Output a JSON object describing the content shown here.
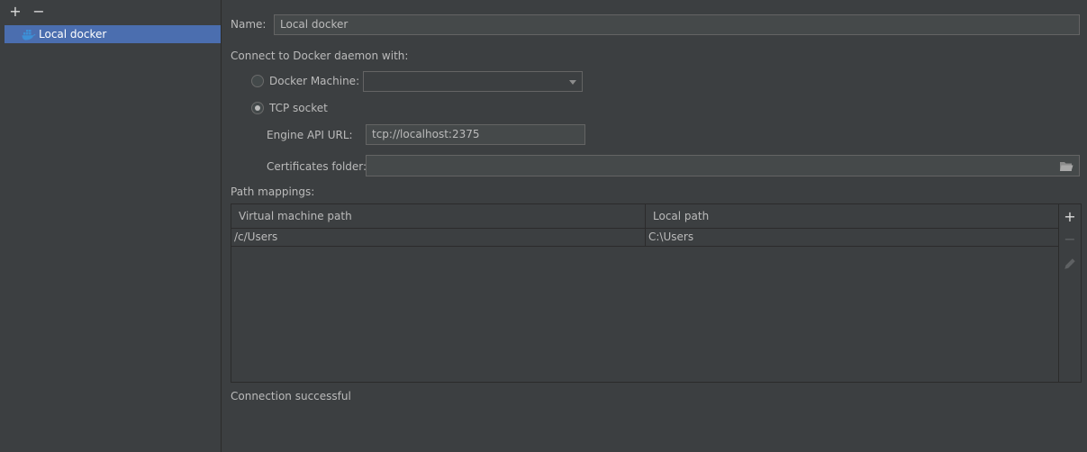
{
  "toolbar": {
    "add_icon": "plus-icon",
    "remove_icon": "minus-icon"
  },
  "tree": {
    "items": [
      {
        "label": "Local docker",
        "icon": "docker-icon"
      }
    ]
  },
  "form": {
    "name_label": "Name:",
    "name_value": "Local docker",
    "connect_label": "Connect to Docker daemon with:",
    "docker_machine_label": "Docker Machine:",
    "docker_machine_value": "",
    "tcp_label": "TCP socket",
    "engine_api_label": "Engine API URL:",
    "engine_api_value": "tcp://localhost:2375",
    "certs_label": "Certificates folder:",
    "certs_value": "",
    "selected_connection": "tcp"
  },
  "mappings": {
    "label": "Path mappings:",
    "columns": [
      "Virtual machine path",
      "Local path"
    ],
    "rows": [
      [
        "/c/Users",
        "C:\\Users"
      ]
    ],
    "actions": [
      "plus-icon",
      "minus-icon",
      "pencil-icon"
    ]
  },
  "status": {
    "text": "Connection successful"
  },
  "colors": {
    "accent": "#4b6eaf",
    "background": "#3c3f41",
    "field": "#45494a",
    "docker_blue": "#3d8fd6"
  }
}
